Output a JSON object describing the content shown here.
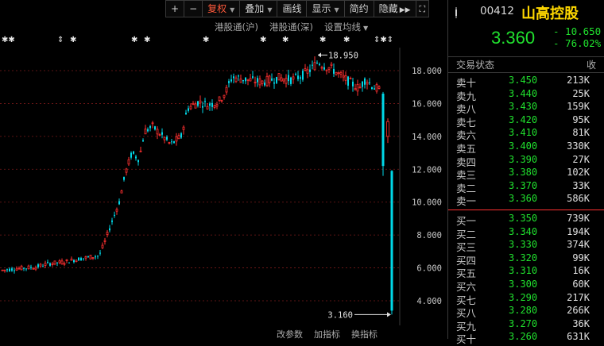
{
  "toolbar": {
    "plus": "+",
    "minus": "−",
    "buttons": [
      {
        "label": "复权",
        "active": true,
        "caret": true
      },
      {
        "label": "叠加",
        "active": false,
        "caret": true
      },
      {
        "label": "画线",
        "active": false,
        "caret": false
      },
      {
        "label": "显示",
        "active": false,
        "caret": true
      },
      {
        "label": "简约",
        "active": false,
        "caret": false
      },
      {
        "label": "隐藏",
        "active": false,
        "caret": false
      }
    ]
  },
  "subbar": {
    "hk_connect_sh": "港股通(沪)",
    "hk_connect_sz": "港股通(深)",
    "ma_settings": "设置均线"
  },
  "bottom": {
    "change_params": "改参数",
    "add_indicator": "加指标",
    "switch_indicator": "换指标"
  },
  "quote": {
    "code": "00412",
    "name": "山高控股",
    "price": "3.360",
    "change": "- 10.650",
    "change_pct": "- 76.02%",
    "status_label": "交易状态",
    "status_right": "收",
    "up_color": "#ff3030",
    "down_color": "#20e02e"
  },
  "order_book": {
    "sells": [
      {
        "label": "卖十",
        "price": "3.450",
        "volume": "213K"
      },
      {
        "label": "卖九",
        "price": "3.440",
        "volume": "25K"
      },
      {
        "label": "卖八",
        "price": "3.430",
        "volume": "159K"
      },
      {
        "label": "卖七",
        "price": "3.420",
        "volume": "95K"
      },
      {
        "label": "卖六",
        "price": "3.410",
        "volume": "81K"
      },
      {
        "label": "卖五",
        "price": "3.400",
        "volume": "330K"
      },
      {
        "label": "卖四",
        "price": "3.390",
        "volume": "27K"
      },
      {
        "label": "卖三",
        "price": "3.380",
        "volume": "102K"
      },
      {
        "label": "卖二",
        "price": "3.370",
        "volume": "33K"
      },
      {
        "label": "卖一",
        "price": "3.360",
        "volume": "586K"
      }
    ],
    "buys": [
      {
        "label": "买一",
        "price": "3.350",
        "volume": "739K"
      },
      {
        "label": "买二",
        "price": "3.340",
        "volume": "194K"
      },
      {
        "label": "买三",
        "price": "3.330",
        "volume": "374K"
      },
      {
        "label": "买四",
        "price": "3.320",
        "volume": "99K"
      },
      {
        "label": "买五",
        "price": "3.310",
        "volume": "16K"
      },
      {
        "label": "买六",
        "price": "3.300",
        "volume": "60K"
      },
      {
        "label": "买七",
        "price": "3.290",
        "volume": "217K"
      },
      {
        "label": "买八",
        "price": "3.280",
        "volume": "266K"
      },
      {
        "label": "买九",
        "price": "3.270",
        "volume": "36K"
      },
      {
        "label": "买十",
        "price": "3.260",
        "volume": "631K"
      }
    ]
  },
  "chart_data": {
    "type": "candlestick",
    "y_ticks": [
      "18.000",
      "16.000",
      "14.000",
      "12.000",
      "10.000",
      "8.000",
      "6.000",
      "4.000"
    ],
    "ylim": [
      2.85,
      19.55
    ],
    "high_label": "18.950",
    "low_label": "3.160",
    "high_value": 18.95,
    "low_value": 3.16,
    "grid": true,
    "up_color": "#ff3030",
    "down_color": "#00d8e8"
  }
}
